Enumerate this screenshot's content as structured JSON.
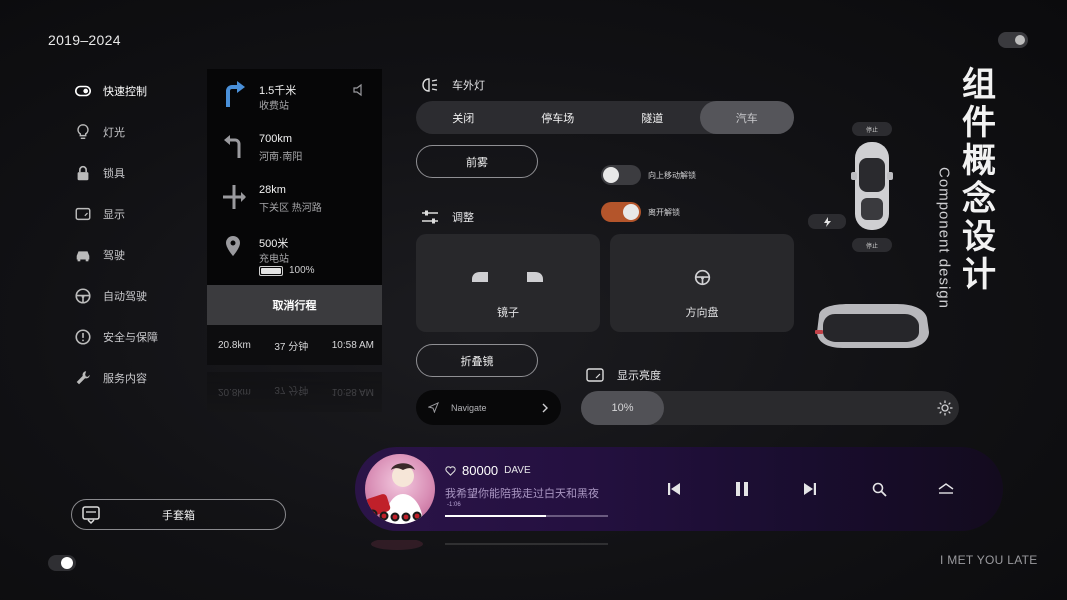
{
  "header": {
    "years": "2019–2024"
  },
  "sidebar": {
    "items": [
      {
        "label": "快速控制",
        "icon": "toggle-icon"
      },
      {
        "label": "灯光",
        "icon": "bulb-icon"
      },
      {
        "label": "锁具",
        "icon": "lock-icon"
      },
      {
        "label": "显示",
        "icon": "display-icon"
      },
      {
        "label": "驾驶",
        "icon": "car-icon"
      },
      {
        "label": "自动驾驶",
        "icon": "steering-wheel-icon"
      },
      {
        "label": "安全与保障",
        "icon": "alert-icon"
      },
      {
        "label": "服务内容",
        "icon": "wrench-icon"
      }
    ],
    "glovebox_label": "手套箱"
  },
  "navigation": {
    "steps": [
      {
        "distance": "1.5千米",
        "place": "收费站",
        "icon": "turn-right-arrow-icon"
      },
      {
        "distance": "700km",
        "place": "河南·南阳",
        "icon": "turn-left-arrow-icon"
      },
      {
        "distance": "28km",
        "place": "下关区 热河路",
        "icon": "crossroad-icon"
      },
      {
        "distance": "500米",
        "place": "充电站",
        "icon": "location-pin-icon"
      }
    ],
    "battery_percent": "100%",
    "battery_level": 1.0,
    "cancel_label": "取消行程",
    "trip": {
      "distance": "20.8km",
      "duration": "37 分钟",
      "arrival": "10:58 AM"
    }
  },
  "exterior_lights": {
    "title": "车外灯",
    "options": [
      "关闭",
      "停车场",
      "隧道",
      "汽车"
    ],
    "selected": "汽车",
    "fog_label": "前雾"
  },
  "toggles": [
    {
      "label": "向上移动解锁",
      "on": false
    },
    {
      "label": "离开解锁",
      "on": true
    }
  ],
  "adjust": {
    "title": "调整",
    "mirror_label": "镜子",
    "wheel_label": "方向盘",
    "fold_label": "折叠镜"
  },
  "navigate_button": {
    "label": "Navigate"
  },
  "display": {
    "title": "显示亮度",
    "brightness": "10%"
  },
  "car_panel": {
    "stop_label": "停止",
    "stop_label_bottom": "停止"
  },
  "page_title": {
    "chinese": "组件概念设计",
    "english": "Component design"
  },
  "player": {
    "song": "80000",
    "artist": "DAVE",
    "lyric": "我希望你能陪我走过白天和黑夜",
    "time": "-1:06",
    "progress": 0.62
  },
  "footer": {
    "text": "I MET YOU LATE"
  },
  "colors": {
    "accent_orange": "#b4552b",
    "player_purple": "#2b1448"
  }
}
